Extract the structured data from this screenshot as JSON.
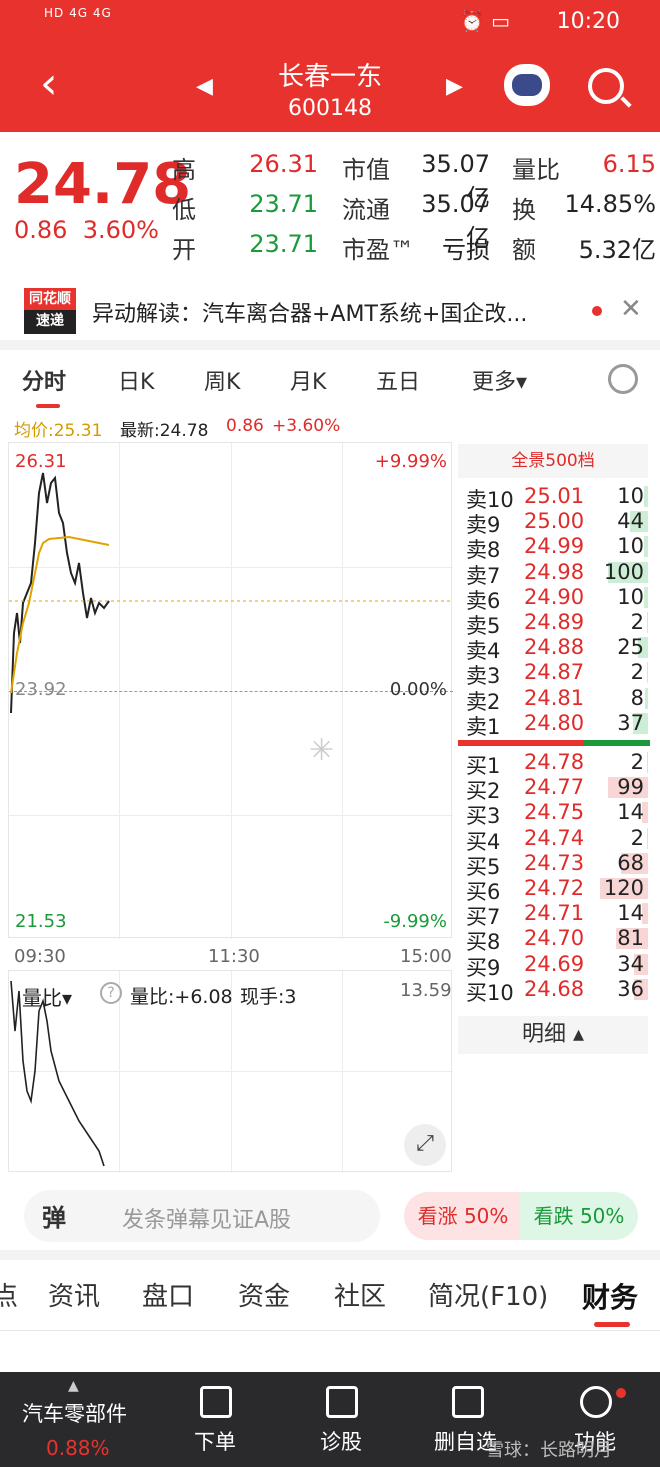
{
  "status": {
    "left": "HD 4G 4G",
    "time": "10:20"
  },
  "header": {
    "title": "长春一东",
    "code": "600148"
  },
  "quote": {
    "price": "24.78",
    "change": "0.86",
    "change_pct": "3.60%",
    "rows": [
      {
        "l1": "高",
        "v1": "26.31",
        "l2": "市值",
        "v2": "35.07亿",
        "l3": "量比",
        "v3": "6.15"
      },
      {
        "l1": "低",
        "v1": "23.71",
        "l2": "流通",
        "v2": "35.07亿",
        "l3": "换",
        "v3": "14.85%"
      },
      {
        "l1": "开",
        "v1": "23.71",
        "l2": "市盈™",
        "v2": "亏损",
        "l3": "额",
        "v3": "5.32亿"
      }
    ]
  },
  "news": {
    "logo_top": "同花顺",
    "logo_bottom": "速递",
    "text": "异动解读：汽车离合器+AMT系统+国企改..."
  },
  "ktabs": [
    "分时",
    "日K",
    "周K",
    "月K",
    "五日",
    "更多▾"
  ],
  "info": {
    "avg": "均价:25.31",
    "latest": "最新:24.78",
    "chg": "0.86",
    "pct": "+3.60%"
  },
  "chart": {
    "high": "26.31",
    "mid": "23.92",
    "low": "21.53",
    "pct_high": "+9.99%",
    "pct_mid": "0.00%",
    "pct_low": "-9.99%",
    "times": [
      "09:30",
      "11:30",
      "15:00"
    ]
  },
  "orderbook": {
    "title": "全景500档",
    "sell": [
      {
        "n": "卖10",
        "p": "25.01",
        "v": "10"
      },
      {
        "n": "卖9",
        "p": "25.00",
        "v": "44"
      },
      {
        "n": "卖8",
        "p": "24.99",
        "v": "10"
      },
      {
        "n": "卖7",
        "p": "24.98",
        "v": "100"
      },
      {
        "n": "卖6",
        "p": "24.90",
        "v": "10"
      },
      {
        "n": "卖5",
        "p": "24.89",
        "v": "2"
      },
      {
        "n": "卖4",
        "p": "24.88",
        "v": "25"
      },
      {
        "n": "卖3",
        "p": "24.87",
        "v": "2"
      },
      {
        "n": "卖2",
        "p": "24.81",
        "v": "8"
      },
      {
        "n": "卖1",
        "p": "24.80",
        "v": "37"
      }
    ],
    "buy": [
      {
        "n": "买1",
        "p": "24.78",
        "v": "2"
      },
      {
        "n": "买2",
        "p": "24.77",
        "v": "99"
      },
      {
        "n": "买3",
        "p": "24.75",
        "v": "14"
      },
      {
        "n": "买4",
        "p": "24.74",
        "v": "2"
      },
      {
        "n": "买5",
        "p": "24.73",
        "v": "68"
      },
      {
        "n": "买6",
        "p": "24.72",
        "v": "120"
      },
      {
        "n": "买7",
        "p": "24.71",
        "v": "14"
      },
      {
        "n": "买8",
        "p": "24.70",
        "v": "81"
      },
      {
        "n": "买9",
        "p": "24.69",
        "v": "34"
      },
      {
        "n": "买10",
        "p": "24.68",
        "v": "36"
      }
    ],
    "detail": "明细 ▴"
  },
  "lower": {
    "label": "量比▾",
    "value": "量比:+6.08",
    "hand": "现手:3",
    "max": "13.59"
  },
  "danmaku": {
    "logo": "弹",
    "placeholder": "发条弹幕见证A股",
    "up": "看涨 50%",
    "down": "看跌 50%"
  },
  "btabs": [
    "点",
    "资讯",
    "盘口",
    "资金",
    "社区",
    "简况(F10)",
    "财务"
  ],
  "bottom": {
    "sector": "汽车零部件",
    "sector_pct": "0.88%",
    "items": [
      "下单",
      "诊股",
      "删自选",
      "功能"
    ],
    "watermark": "雪球：长路明月"
  }
}
